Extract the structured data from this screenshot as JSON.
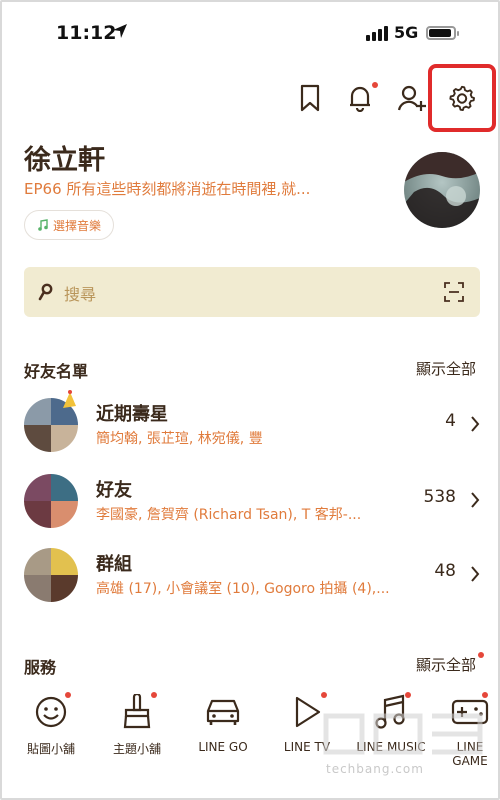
{
  "status_bar": {
    "time": "11:12",
    "network": "5G"
  },
  "profile": {
    "name": "徐立軒",
    "status_message": "EP66 所有這些時刻都將消逝在時間裡,就...",
    "music_chip_label": "選擇音樂"
  },
  "search": {
    "placeholder": "搜尋"
  },
  "friends_section": {
    "title": "好友名單",
    "show_all": "顯示全部",
    "rows": [
      {
        "title": "近期壽星",
        "subtitle": "簡均翰, 張芷瑄, 林宛儀, 豐",
        "count": "4"
      },
      {
        "title": "好友",
        "subtitle": "李國豪, 詹賀齊 (Richard Tsan), T 客邦-...",
        "count": "538"
      },
      {
        "title": "群組",
        "subtitle": "高雄 (17), 小會議室 (10), Gogoro 拍攝 (4),...",
        "count": "48"
      }
    ]
  },
  "services_section": {
    "title": "服務",
    "show_all": "顯示全部",
    "items": [
      {
        "label": "貼圖小舖",
        "icon": "smiley-icon"
      },
      {
        "label": "主題小舖",
        "icon": "paintbrush-icon"
      },
      {
        "label": "LINE GO",
        "icon": "car-icon"
      },
      {
        "label": "LINE TV",
        "icon": "play-icon"
      },
      {
        "label": "LINE MUSIC",
        "icon": "music-note-icon"
      },
      {
        "label": "LINE GAME",
        "icon": "gamepad-icon"
      }
    ]
  },
  "watermark": {
    "text": "techbang.com"
  },
  "colors": {
    "accent_orange": "#e07b3c",
    "dark_brown": "#3b2a1c",
    "search_bg": "#f1ebd1",
    "notify_red": "#e5473a",
    "highlight_red": "#e02b2b"
  }
}
